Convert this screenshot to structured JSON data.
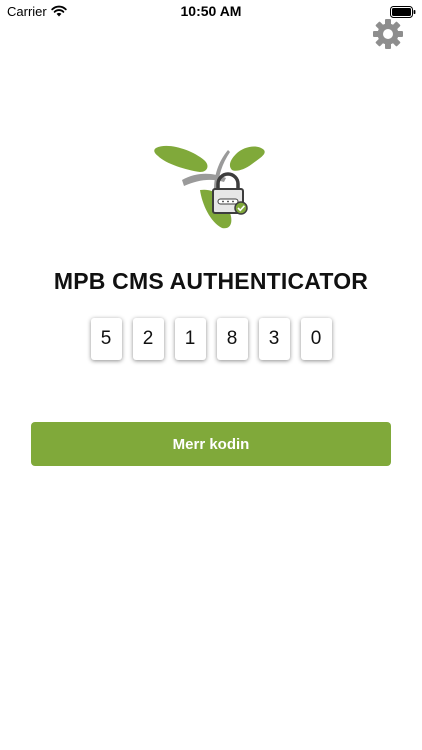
{
  "status_bar": {
    "carrier": "Carrier",
    "time": "10:50 AM",
    "wifi_icon": "wifi-icon",
    "battery_icon": "battery-icon"
  },
  "header": {
    "settings_icon": "gear-icon"
  },
  "logo": {
    "icon": "app-logo-lock-icon",
    "colors": {
      "green": "#80a93a",
      "gray": "#9a9a9a"
    }
  },
  "app_title": "MPB CMS AUTHENTICATOR",
  "code_digits": [
    "5",
    "2",
    "1",
    "8",
    "3",
    "0"
  ],
  "get_code_button": {
    "label": "Merr kodin",
    "color": "#80a93a"
  }
}
